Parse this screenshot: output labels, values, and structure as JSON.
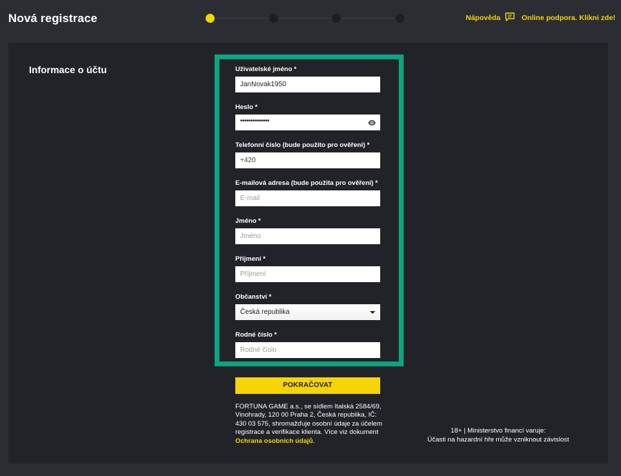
{
  "header": {
    "title": "Nová registrace",
    "steps": {
      "total": 4,
      "active": 1
    },
    "help_label": "Nápověda",
    "support_label": "Online podpora. Klikni zde!",
    "icons": {
      "support": "chat-icon"
    }
  },
  "section": {
    "title": "Informace o účtu"
  },
  "form": {
    "username": {
      "label": "Uživatelské jméno *",
      "value": "JanNovak1950"
    },
    "password": {
      "label": "Heslo *",
      "value": "••••••••••••••",
      "icon": "eye-icon"
    },
    "phone": {
      "label": "Telefonní číslo (bude použito pro ověření) *",
      "value": "+420"
    },
    "email": {
      "label": "E-mailová adresa (bude použita pro ověření) *",
      "placeholder": "E-mail"
    },
    "first_name": {
      "label": "Jméno *",
      "placeholder": "Jméno"
    },
    "last_name": {
      "label": "Příjmení *",
      "placeholder": "Příjmení"
    },
    "citizenship": {
      "label": "Občanství *",
      "selected": "Česká republika"
    },
    "birth_number": {
      "label": "Rodné číslo *",
      "placeholder": "Rodné číslo"
    },
    "continue_label": "POKRAČOVAT"
  },
  "legal": {
    "text": "FORTUNA GAME a.s., se sídlem Italská 2584/69, Vinohrady, 120 00 Praha 2, Česká republika, IČ: 430 03 575, shromažďuje osobní údaje za účelem registrace a verifikace klienta. Více viz dokument ",
    "link": "Ochrana osobních údajů",
    "suffix": "."
  },
  "warning": {
    "line1": "18+ | Ministerstvo financí varuje:",
    "line2": "Účasti na hazardní hře může vzniknout závislost"
  },
  "colors": {
    "accent": "#f5d503",
    "highlight": "#0aa582",
    "background": "#2b2d33",
    "panel": "#222328"
  }
}
